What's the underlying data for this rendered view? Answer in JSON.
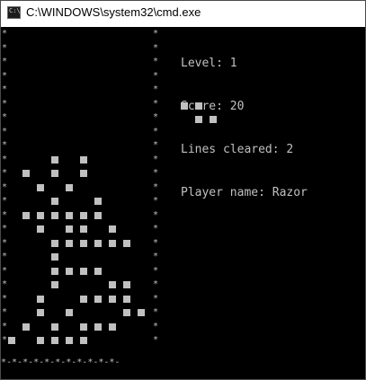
{
  "window": {
    "title": "C:\\WINDOWS\\system32\\cmd.exe",
    "icon": "cmd-icon",
    "icon_text": "C:\\"
  },
  "hud": {
    "level_label": "Level: 1",
    "score_label": "Score: 20",
    "lines_label": "Lines cleared: 2",
    "player_label": "Player name: Razor"
  },
  "board": {
    "wall_char": "*",
    "floor": "*-*-*-*-*-*-*-*-*-*-*-",
    "rows": [
      "..........",
      "..........",
      "..........",
      "..........",
      "..........",
      "..........",
      "..........",
      "..........",
      "..........",
      "...#.#....",
      ".#.#.#....",
      "..#.#.....",
      "...#..#...",
      ".######...",
      "..#.##.#..",
      "...######.",
      "...#......",
      "...####...",
      "...#...##.",
      "..#..####.",
      "..#.#...##",
      ".#.#.###..",
      "#.####...."
    ]
  },
  "next_piece": {
    "label": "",
    "rows": [
      "##.",
      ".##"
    ]
  },
  "colors": {
    "console_bg": "#000000",
    "console_fg": "#c0c0c0",
    "titlebar_bg": "#ffffff"
  }
}
